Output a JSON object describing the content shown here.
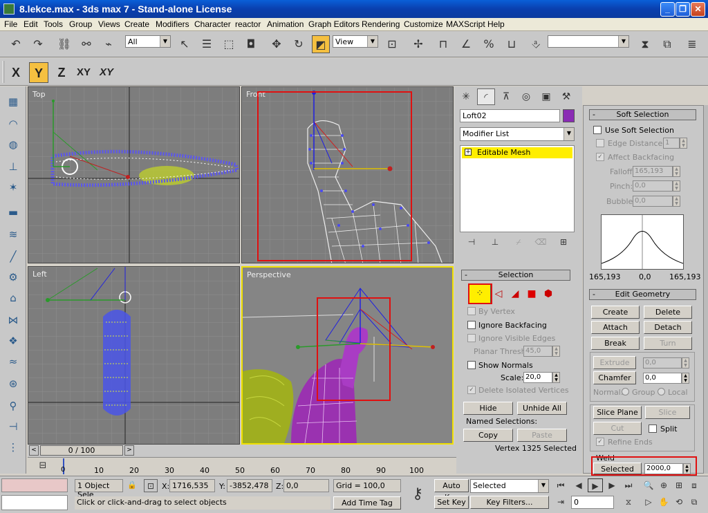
{
  "window": {
    "title": "8.lekce.max - 3ds max 7   - Stand-alone License",
    "min": "_",
    "max": "❐",
    "close": "✕"
  },
  "menu": [
    "File",
    "Edit",
    "Tools",
    "Group",
    "Views",
    "Create",
    "Modifiers",
    "Character",
    "reactor",
    "Animation",
    "Graph Editors",
    "Rendering",
    "Customize",
    "MAXScript",
    "Help"
  ],
  "toolbar": {
    "filter": "All",
    "refcoord": "View",
    "named_sel": ""
  },
  "axis": {
    "x": "X",
    "y": "Y",
    "z": "Z",
    "xy": "XY",
    "yx": "XY"
  },
  "viewports": {
    "top": "Top",
    "front": "Front",
    "left": "Left",
    "perspective": "Perspective"
  },
  "cmd": {
    "object_name": "Loft02",
    "object_color": "#8a2bb4",
    "modifier_list": "Modifier List",
    "stack_item": "Editable Mesh",
    "stack_plus": "+"
  },
  "selection": {
    "title": "Selection",
    "by_vertex": "By Vertex",
    "ignore_backfacing": "Ignore Backfacing",
    "ignore_visible_edges": "Ignore Visible Edges",
    "planar_thresh_label": "Planar Thresh:",
    "planar_thresh": "45,0",
    "show_normals": "Show Normals",
    "scale_label": "Scale:",
    "scale": "20,0",
    "delete_isolated": "Delete Isolated Vertices",
    "hide": "Hide",
    "unhide_all": "Unhide All",
    "named_selections": "Named Selections:",
    "copy": "Copy",
    "paste": "Paste",
    "status": "Vertex 1325 Selected"
  },
  "soft": {
    "title": "Soft Selection",
    "use": "Use Soft Selection",
    "edge_distance": "Edge Distance:",
    "edge_distance_val": "1",
    "affect_backfacing": "Affect Backfacing",
    "falloff_label": "Falloff:",
    "falloff": "165,193",
    "pinch_label": "Pinch:",
    "pinch": "0,0",
    "bubble_label": "Bubble:",
    "bubble": "0,0",
    "curve_left": "165,193",
    "curve_mid": "0,0",
    "curve_right": "165,193"
  },
  "edit_geometry": {
    "title": "Edit Geometry",
    "create": "Create",
    "delete": "Delete",
    "attach": "Attach",
    "detach": "Detach",
    "break": "Break",
    "turn": "Turn",
    "extrude": "Extrude",
    "extrude_val": "0,0",
    "chamfer": "Chamfer",
    "chamfer_val": "0,0",
    "normal_label": "Normal:",
    "group": "Group",
    "local": "Local",
    "slice_plane": "Slice Plane",
    "slice": "Slice",
    "cut": "Cut",
    "split": "Split",
    "refine_ends": "Refine Ends",
    "weld": "Weld",
    "selected": "Selected",
    "weld_val": "2000,0"
  },
  "timeline": {
    "frame": "0 / 100",
    "ticks": [
      "0",
      "10",
      "20",
      "30",
      "40",
      "50",
      "60",
      "70",
      "80",
      "90",
      "100"
    ]
  },
  "status": {
    "objects": "1 Object Sele",
    "x_label": "X:",
    "x": "1716,535",
    "y_label": "Y:",
    "y": "-3852,478",
    "z_label": "Z:",
    "z": "0,0",
    "grid": "Grid = 100,0",
    "prompt": "Click or click-and-drag to select objects",
    "add_time_tag": "Add Time Tag",
    "auto_key": "Auto Key",
    "set_key": "Set Key",
    "key_mode": "Selected",
    "key_filters": "Key Filters...",
    "frame": "0"
  }
}
